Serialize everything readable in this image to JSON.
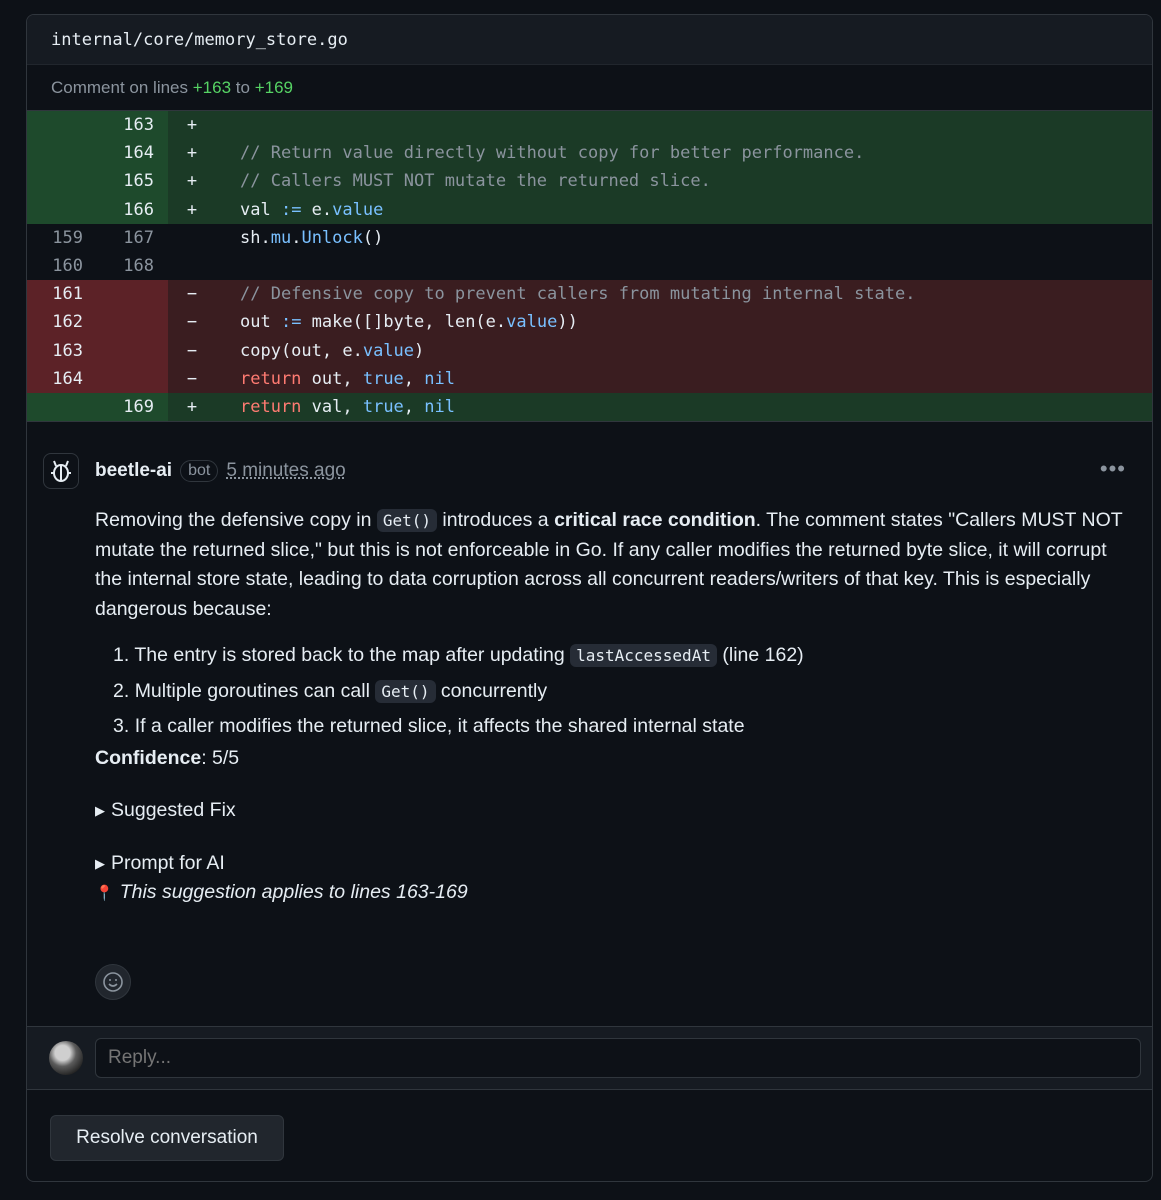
{
  "file": {
    "path": "internal/core/memory_store.go"
  },
  "comment_on": {
    "prefix": "Comment on lines",
    "from": "+163",
    "sep": "to",
    "to": "+169"
  },
  "diff_rows": [
    {
      "type": "add",
      "old": "",
      "new": "163",
      "sign": "+",
      "code": ""
    },
    {
      "type": "add",
      "old": "",
      "new": "164",
      "sign": "+",
      "code": "// Return value directly without copy for better performance."
    },
    {
      "type": "add",
      "old": "",
      "new": "165",
      "sign": "+",
      "code": "// Callers MUST NOT mutate the returned slice."
    },
    {
      "type": "add",
      "old": "",
      "new": "166",
      "sign": "+",
      "code": "val := e.value"
    },
    {
      "type": "ctx",
      "old": "159",
      "new": "167",
      "sign": "",
      "code": "sh.mu.Unlock()"
    },
    {
      "type": "ctx",
      "old": "160",
      "new": "168",
      "sign": "",
      "code": ""
    },
    {
      "type": "del",
      "old": "161",
      "new": "",
      "sign": "−",
      "code": "// Defensive copy to prevent callers from mutating internal state."
    },
    {
      "type": "del",
      "old": "162",
      "new": "",
      "sign": "−",
      "code": "out := make([]byte, len(e.value))"
    },
    {
      "type": "del",
      "old": "163",
      "new": "",
      "sign": "−",
      "code": "copy(out, e.value)"
    },
    {
      "type": "del",
      "old": "164",
      "new": "",
      "sign": "−",
      "code": "return out, true, nil"
    },
    {
      "type": "add",
      "old": "",
      "new": "169",
      "sign": "+",
      "code": "return val, true, nil"
    }
  ],
  "comment": {
    "author": "beetle-ai",
    "badge": "bot",
    "time": "5 minutes ago",
    "more_icon": "kebab-horizontal-icon",
    "p1": {
      "a": "Removing the defensive copy in ",
      "code": "Get()",
      "b": " introduces a ",
      "strong": "critical race condition",
      "c": ". The comment states \"Callers MUST NOT mutate the returned slice,\" but this is not enforceable in Go. If any caller modifies the returned byte slice, it will corrupt the internal store state, leading to data corruption across all concurrent readers/writers of that key. This is especially dangerous because:"
    },
    "list": [
      {
        "n": "1.",
        "a": "The entry is stored back to the map after updating ",
        "code": "lastAccessedAt",
        "b": " (line 162)"
      },
      {
        "n": "2.",
        "a": "Multiple goroutines can call ",
        "code": "Get()",
        "b": " concurrently"
      },
      {
        "n": "3.",
        "a": "If a caller modifies the returned slice, it affects the shared internal state",
        "code": "",
        "b": ""
      }
    ],
    "confidence_label": "Confidence",
    "confidence_value": ": 5/5",
    "suggested_fix": "Suggested Fix",
    "prompt_for_ai": "Prompt for AI",
    "applies_to": "This suggestion applies to lines 163-169"
  },
  "reply": {
    "placeholder": "Reply..."
  },
  "resolve": {
    "label": "Resolve conversation"
  }
}
